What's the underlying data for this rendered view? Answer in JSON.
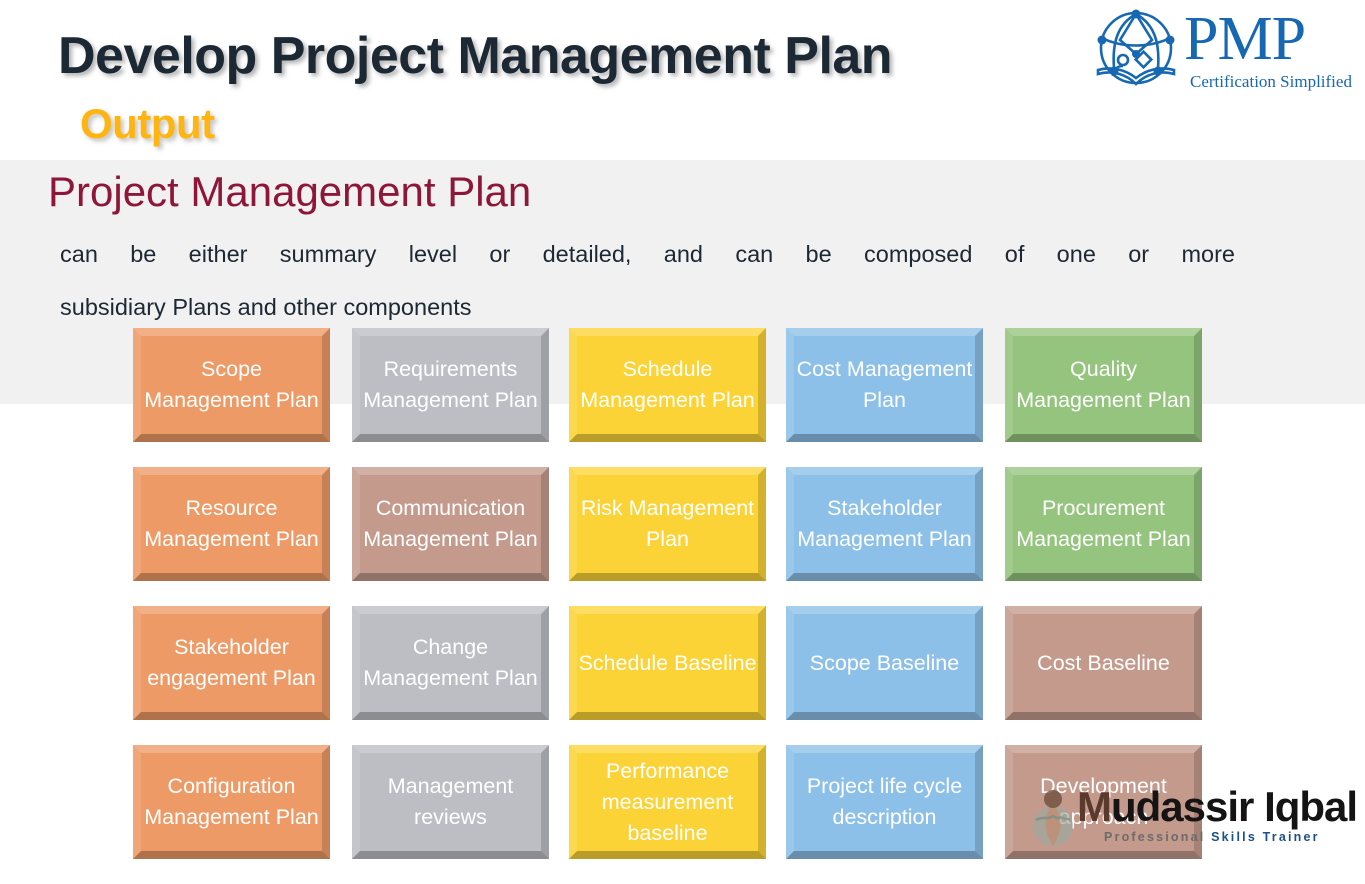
{
  "header": {
    "title": "Develop Project Management Plan",
    "subtitle": "Output",
    "logo": {
      "word": "PMP",
      "tagline": "Certification Simplified",
      "icon": "pmp-network-book-icon",
      "color": "#1668b3"
    }
  },
  "section": {
    "heading": "Project Management Plan",
    "heading_color": "#8e1638",
    "body_line1": "can be either summary level or detailed, and can be composed of one or more",
    "body_line2": "subsidiary Plans and other components"
  },
  "grid": {
    "rows": [
      [
        {
          "label": "Scope Management Plan",
          "color": "#ee9a66"
        },
        {
          "label": "Requirements Management Plan",
          "color": "#bcbec4"
        },
        {
          "label": "Schedule Management Plan",
          "color": "#fcd336"
        },
        {
          "label": "Cost Management Plan",
          "color": "#8cc0e8"
        },
        {
          "label": "Quality Management Plan",
          "color": "#94c47d"
        }
      ],
      [
        {
          "label": "Resource Management Plan",
          "color": "#ee9a66"
        },
        {
          "label": "Communication Management Plan",
          "color": "#c49a8c"
        },
        {
          "label": "Risk Management Plan",
          "color": "#fcd336"
        },
        {
          "label": "Stakeholder Management Plan",
          "color": "#8cc0e8"
        },
        {
          "label": "Procurement Management Plan",
          "color": "#94c47d"
        }
      ],
      [
        {
          "label": "Stakeholder engagement Plan",
          "color": "#ee9a66"
        },
        {
          "label": "Change Management Plan",
          "color": "#bcbec4"
        },
        {
          "label": "Schedule Baseline",
          "color": "#fcd336"
        },
        {
          "label": "Scope Baseline",
          "color": "#8cc0e8"
        },
        {
          "label": "Cost Baseline",
          "color": "#c49a8c"
        }
      ],
      [
        {
          "label": "Configuration Management Plan",
          "color": "#ee9a66"
        },
        {
          "label": "Management reviews",
          "color": "#bcbec4"
        },
        {
          "label": "Performance measurement baseline",
          "color": "#fcd336"
        },
        {
          "label": "Project life cycle description",
          "color": "#8cc0e8"
        },
        {
          "label": "Development approach",
          "color": "#c49a8c"
        }
      ]
    ]
  },
  "watermark": {
    "name_prefix": "M",
    "name_rest": "udassir Iqbal",
    "tagline_part1": "Professional ",
    "tagline_part2": "Skills Trainer",
    "icon": "mudassir-person-globe-icon"
  }
}
